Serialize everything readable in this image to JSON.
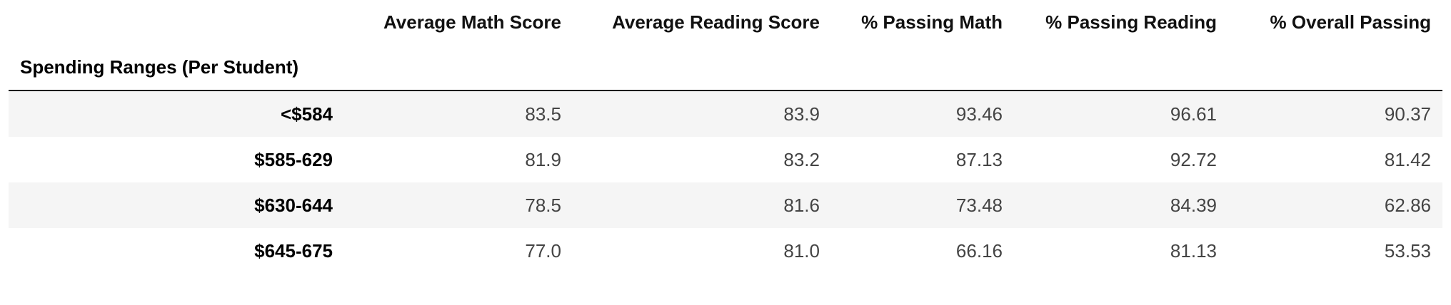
{
  "table": {
    "index_name": "Spending Ranges (Per Student)",
    "columns": [
      "Average Math Score",
      "Average Reading Score",
      "% Passing Math",
      "% Passing Reading",
      "% Overall Passing"
    ],
    "rows": [
      {
        "label": "<$584",
        "values": [
          "83.5",
          "83.9",
          "93.46",
          "96.61",
          "90.37"
        ]
      },
      {
        "label": "$585-629",
        "values": [
          "81.9",
          "83.2",
          "87.13",
          "92.72",
          "81.42"
        ]
      },
      {
        "label": "$630-644",
        "values": [
          "78.5",
          "81.6",
          "73.48",
          "84.39",
          "62.86"
        ]
      },
      {
        "label": "$645-675",
        "values": [
          "77.0",
          "81.0",
          "66.16",
          "81.13",
          "53.53"
        ]
      }
    ]
  },
  "chart_data": {
    "type": "table",
    "index_name": "Spending Ranges (Per Student)",
    "columns": [
      "Average Math Score",
      "Average Reading Score",
      "% Passing Math",
      "% Passing Reading",
      "% Overall Passing"
    ],
    "rows": [
      "<$584",
      "$585-629",
      "$630-644",
      "$645-675"
    ],
    "values": [
      [
        83.5,
        83.9,
        93.46,
        96.61,
        90.37
      ],
      [
        81.9,
        83.2,
        87.13,
        92.72,
        81.42
      ],
      [
        78.5,
        81.6,
        73.48,
        84.39,
        62.86
      ],
      [
        77.0,
        81.0,
        66.16,
        81.13,
        53.53
      ]
    ]
  }
}
